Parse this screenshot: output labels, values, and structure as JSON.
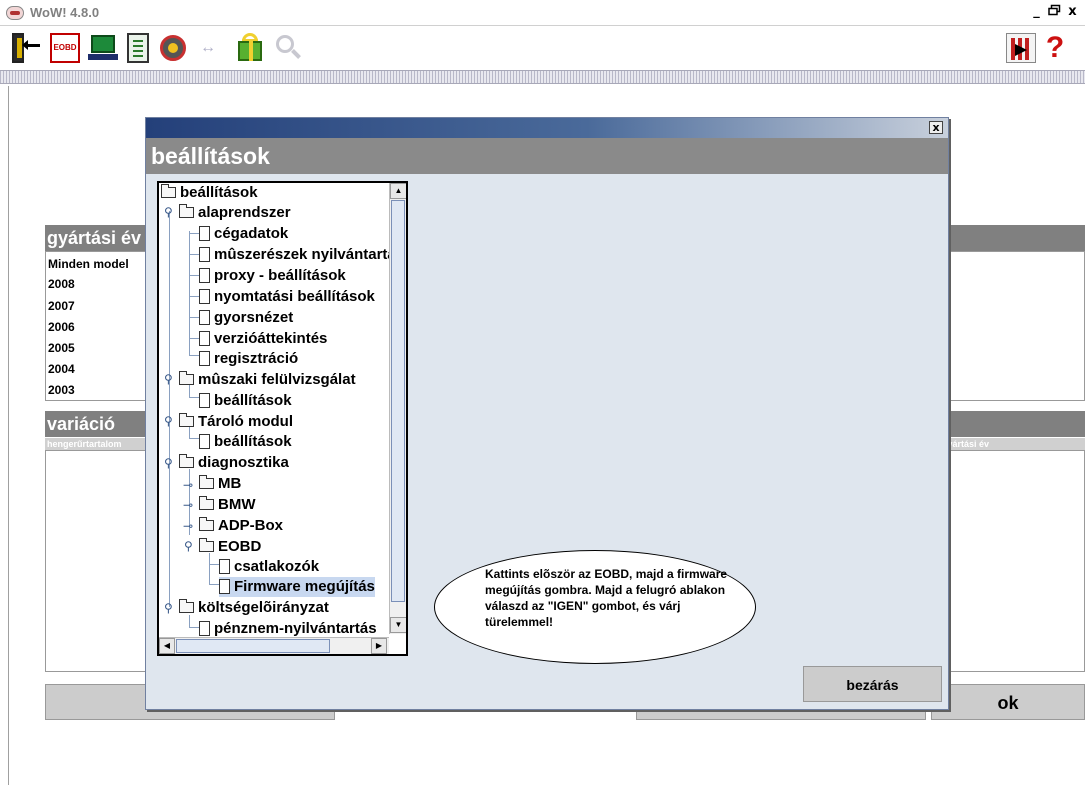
{
  "window": {
    "title": "WoW! 4.8.0",
    "minimize": "_",
    "maximize": " ",
    "close": "x"
  },
  "toolbar": {
    "eobd_label": "EOBD",
    "help_glyph": "?"
  },
  "background": {
    "year_header": "gyártási év",
    "year_list": [
      "Minden model",
      "2008",
      "2007",
      "2006",
      "2005",
      "2004",
      "2003"
    ],
    "variation_header": "variáció",
    "variation_col_left": "hengerűrtartalom",
    "variation_col_right": "gyártási év",
    "ok_label": "ok"
  },
  "dialog": {
    "close_glyph": "x",
    "heading": "beállítások",
    "tree": {
      "root": "beállítások",
      "alaprendszer": "alaprendszer",
      "cegadatok": "cégadatok",
      "muszereszek": "mûszerészek nyilvántartása",
      "proxy": "proxy - beállítások",
      "nyomtatasi": "nyomtatási beállítások",
      "gyorsnezet": "gyorsnézet",
      "verzio": "verzióáttekintés",
      "regisztracio": "regisztráció",
      "muszaki": "mûszaki felülvizsgálat",
      "muszaki_beallitasok": "beállítások",
      "tarolo": "Tároló modul",
      "tarolo_beallitasok": "beállítások",
      "diagnosztika": "diagnosztika",
      "mb": "MB",
      "bmw": "BMW",
      "adp": "ADP-Box",
      "eobd": "EOBD",
      "csatlakozok": "csatlakozók",
      "firmware": "Firmware megújítás",
      "koltseg": "költségelõirányzat",
      "penznem": "pénznem-nyilvántartás"
    },
    "hint": "Kattints elõször az EOBD, majd a firmware megújítás gombra. Majd a felugró ablakon válaszd az \"IGEN\" gombot, és várj türelemmel!",
    "close_button": "bezárás"
  }
}
